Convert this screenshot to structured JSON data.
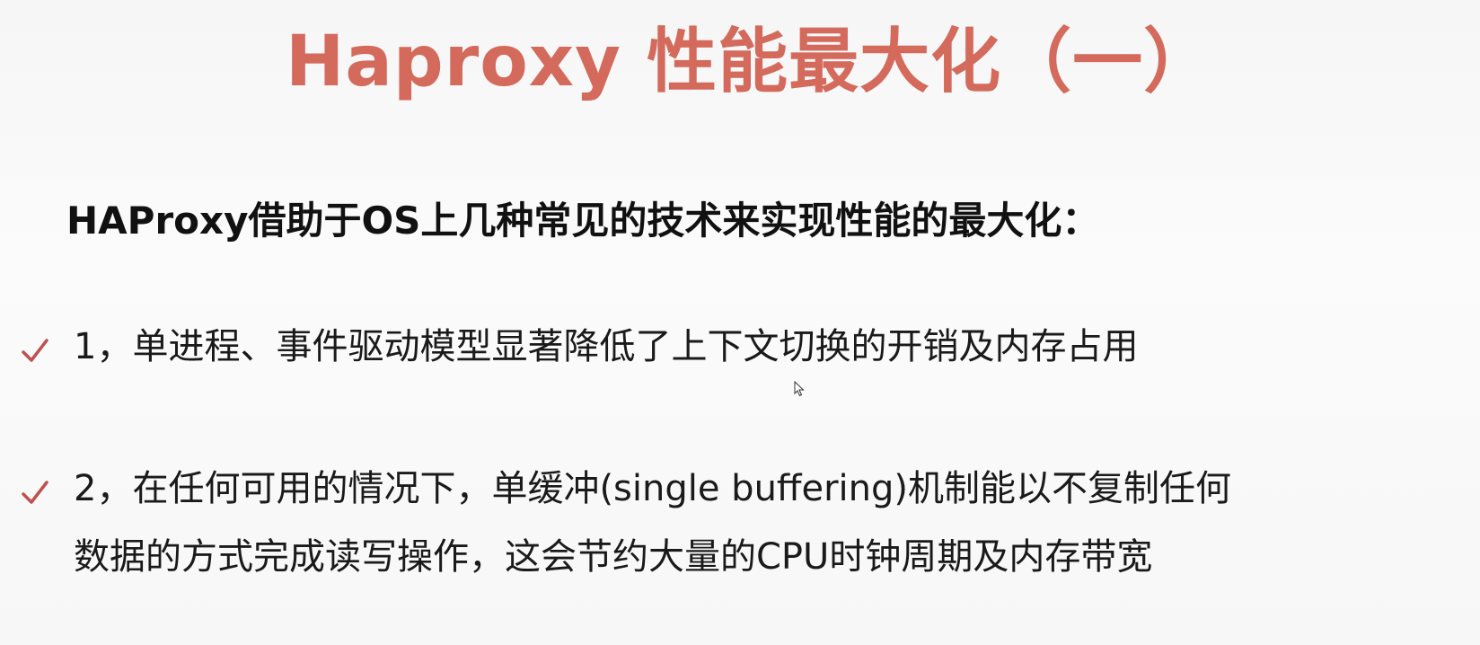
{
  "slide": {
    "title": "Haproxy 性能最大化（一）",
    "subtitle": "HAProxy借助于OS上几种常见的技术来实现性能的最大化：",
    "bullets": [
      {
        "icon": "checkmark-icon",
        "lines": [
          "1，单进程、事件驱动模型显著降低了上下文切换的开销及内存占用"
        ]
      },
      {
        "icon": "checkmark-icon",
        "lines": [
          "2，在任何可用的情况下，单缓冲(single buffering)机制能以不复制任何",
          "数据的方式完成读写操作，这会节约大量的CPU时钟周期及内存带宽"
        ]
      }
    ]
  },
  "colors": {
    "title": "#d46a5c",
    "check": "#c0504d",
    "text": "#1a1a1a",
    "background": "#fafafa"
  },
  "cursor": {
    "icon": "mouse-pointer-icon"
  }
}
